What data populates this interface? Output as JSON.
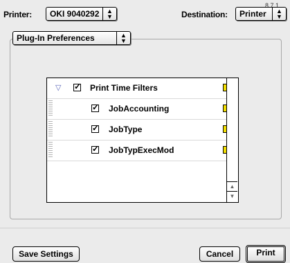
{
  "version": "8.7.1",
  "printer": {
    "label": "Printer:",
    "value": "OKI 9040292"
  },
  "destination": {
    "label": "Destination:",
    "value": "Printer"
  },
  "panel": {
    "value": "Plug-In Preferences"
  },
  "filters": {
    "group": {
      "label": "Print Time Filters",
      "expanded": true,
      "checked": true
    },
    "items": [
      {
        "label": "JobAccounting",
        "checked": true
      },
      {
        "label": "JobType",
        "checked": true
      },
      {
        "label": "JobTypExecMod",
        "checked": true
      }
    ],
    "info_glyph": "i"
  },
  "icons": {
    "popup_arrows": "updown-arrows-icon",
    "disclosure": "triangle-down-icon",
    "check": "checkmark-icon",
    "info": "info-icon"
  },
  "buttons": {
    "save": "Save Settings",
    "cancel": "Cancel",
    "print": "Print"
  }
}
